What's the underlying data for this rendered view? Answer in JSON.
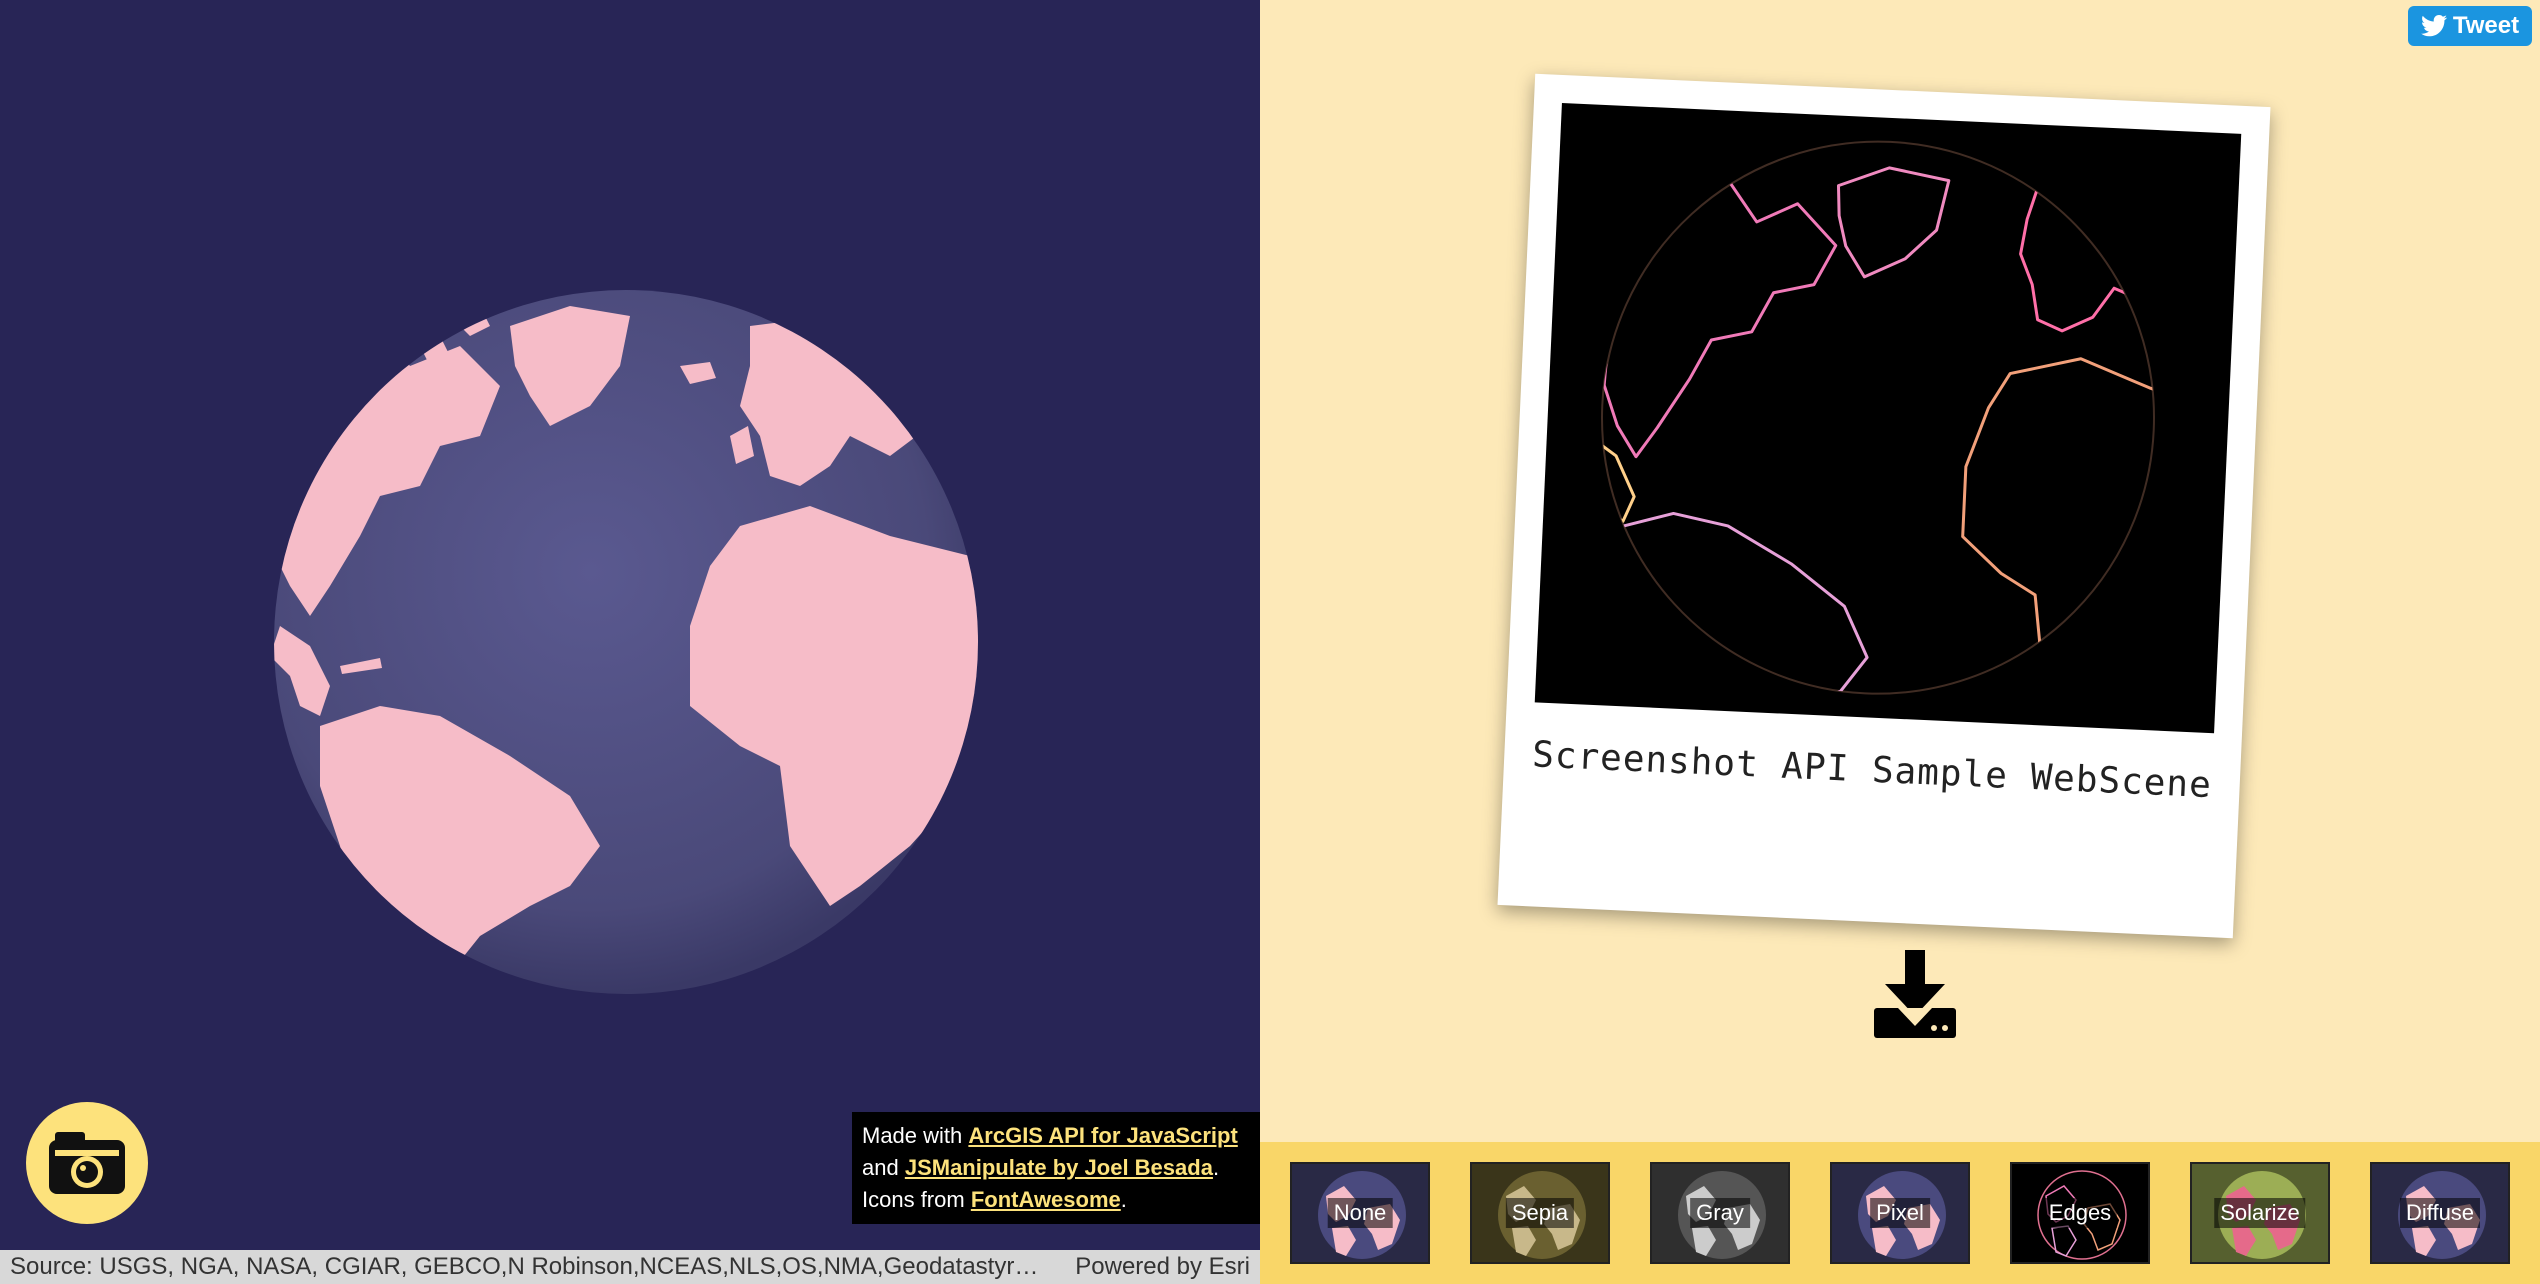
{
  "colors": {
    "left_bg": "#282556",
    "globe_land": "#f6bcc8",
    "globe_water": "#4b4a7a",
    "right_bg": "#fde9b8",
    "filter_bar": "#f9d668",
    "accent_yellow": "#fde27c",
    "tweet_blue": "#1b95e0"
  },
  "credits": {
    "line1_prefix": "Made with ",
    "line1_link": "ArcGIS API for JavaScript",
    "line2_prefix": "and ",
    "line2_link": "JSManipulate by Joel Besada",
    "line2_suffix": ".",
    "line3_prefix": "Icons from ",
    "line3_link": "FontAwesome",
    "line3_suffix": "."
  },
  "attribution": {
    "source": "Source: USGS, NGA, NASA, CGIAR, GEBCO,N Robinson,NCEAS,NLS,OS,NMA,Geodatastyrelsen,Rijkswaterstaat,GSA,Geoland,FEMA,Intermap and the GIS user community",
    "powered": "Powered by Esri"
  },
  "tweet": {
    "label": "Tweet",
    "icon": "twitter-bird-icon"
  },
  "polaroid": {
    "caption": "Screenshot API Sample WebScene"
  },
  "camera": {
    "icon": "camera-icon"
  },
  "download": {
    "icon": "download-icon"
  },
  "filters": [
    {
      "label": "None",
      "tint": "#4a4a7e",
      "land": "#f6bcc8"
    },
    {
      "label": "Sepia",
      "tint": "#6a6030",
      "land": "#c8b88a"
    },
    {
      "label": "Gray",
      "tint": "#555555",
      "land": "#cccccc"
    },
    {
      "label": "Pixel",
      "tint": "#4a4a7e",
      "land": "#f6bcc8"
    },
    {
      "label": "Edges",
      "tint": "#000000",
      "land": "#000000"
    },
    {
      "label": "Solarize",
      "tint": "#9cae55",
      "land": "#e56a8a"
    },
    {
      "label": "Diffuse",
      "tint": "#4a4a7e",
      "land": "#f6bcc8"
    }
  ]
}
